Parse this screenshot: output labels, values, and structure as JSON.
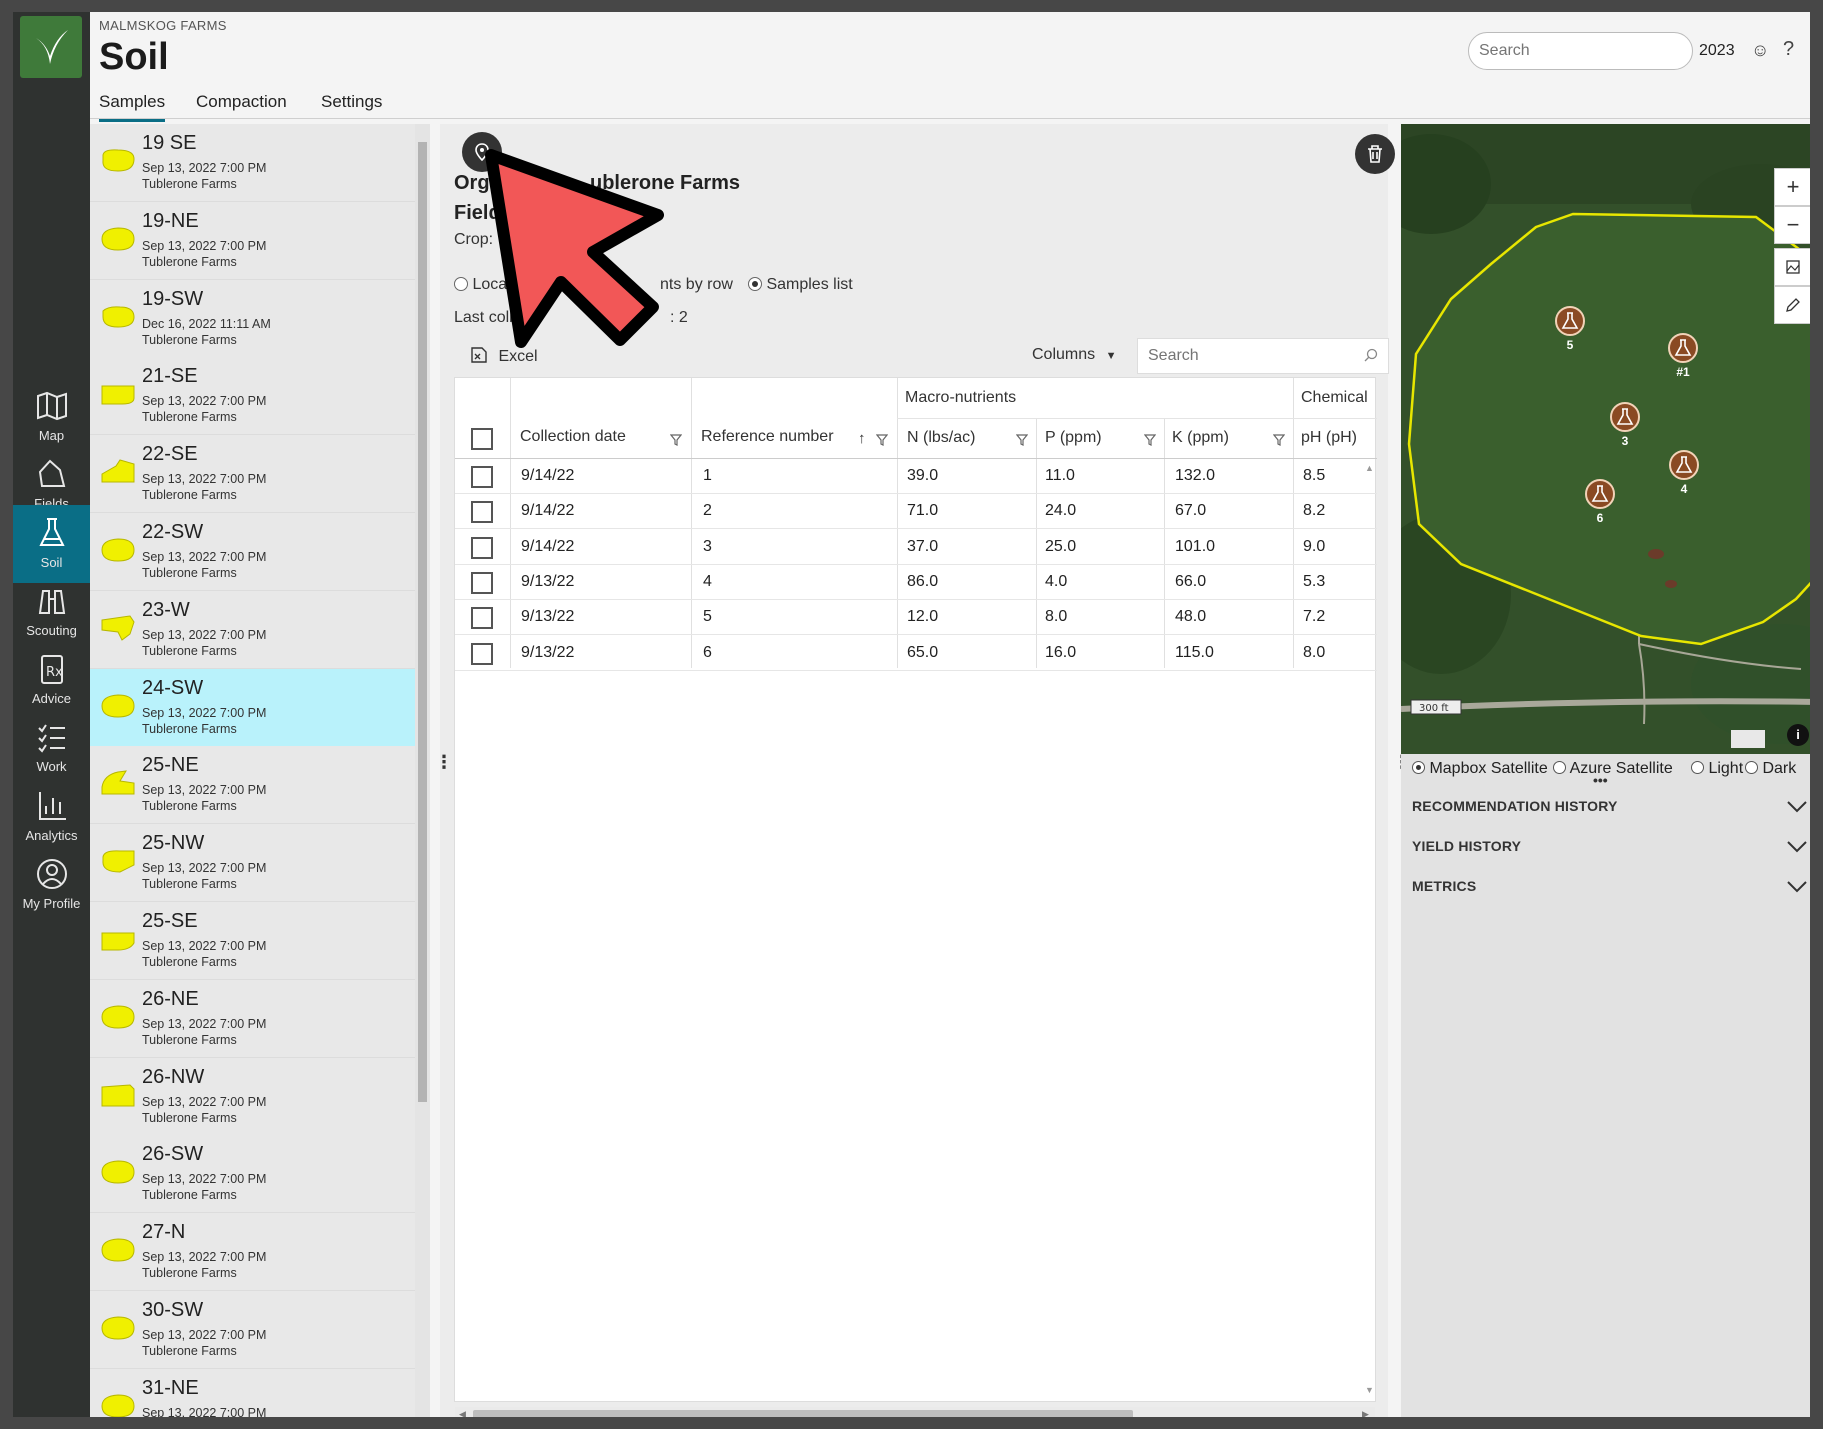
{
  "header": {
    "org": "MALMSKOG FARMS",
    "title": "Soil",
    "tabs": [
      "Samples",
      "Compaction",
      "Settings"
    ],
    "search_placeholder": "Search",
    "year": "2023",
    "smile_icon": "☺",
    "help_icon": "?"
  },
  "nav": {
    "items": [
      {
        "label": "Map",
        "icon": "map-icon"
      },
      {
        "label": "Fields",
        "icon": "fields-icon"
      },
      {
        "label": "Soil",
        "icon": "flask-icon",
        "active": true
      },
      {
        "label": "Scouting",
        "icon": "binoculars-icon"
      },
      {
        "label": "Advice",
        "icon": "rx-icon"
      },
      {
        "label": "Work",
        "icon": "checklist-icon"
      },
      {
        "label": "Analytics",
        "icon": "chart-icon"
      },
      {
        "label": "My Profile",
        "icon": "profile-icon"
      }
    ]
  },
  "fields": [
    {
      "name": "19 SE",
      "date": "Sep 13, 2022 7:00 PM",
      "farm": "Tublerone Farms"
    },
    {
      "name": "19-NE",
      "date": "Sep 13, 2022 7:00 PM",
      "farm": "Tublerone Farms"
    },
    {
      "name": "19-SW",
      "date": "Dec 16, 2022 11:11 AM",
      "farm": "Tublerone Farms"
    },
    {
      "name": "21-SE",
      "date": "Sep 13, 2022 7:00 PM",
      "farm": "Tublerone Farms"
    },
    {
      "name": "22-SE",
      "date": "Sep 13, 2022 7:00 PM",
      "farm": "Tublerone Farms"
    },
    {
      "name": "22-SW",
      "date": "Sep 13, 2022 7:00 PM",
      "farm": "Tublerone Farms"
    },
    {
      "name": "23-W",
      "date": "Sep 13, 2022 7:00 PM",
      "farm": "Tublerone Farms"
    },
    {
      "name": "24-SW",
      "date": "Sep 13, 2022 7:00 PM",
      "farm": "Tublerone Farms",
      "selected": true
    },
    {
      "name": "25-NE",
      "date": "Sep 13, 2022 7:00 PM",
      "farm": "Tublerone Farms"
    },
    {
      "name": "25-NW",
      "date": "Sep 13, 2022 7:00 PM",
      "farm": "Tublerone Farms"
    },
    {
      "name": "25-SE",
      "date": "Sep 13, 2022 7:00 PM",
      "farm": "Tublerone Farms"
    },
    {
      "name": "26-NE",
      "date": "Sep 13, 2022 7:00 PM",
      "farm": "Tublerone Farms"
    },
    {
      "name": "26-NW",
      "date": "Sep 13, 2022 7:00 PM",
      "farm": "Tublerone Farms"
    },
    {
      "name": "26-SW",
      "date": "Sep 13, 2022 7:00 PM",
      "farm": "Tublerone Farms"
    },
    {
      "name": "27-N",
      "date": "Sep 13, 2022 7:00 PM",
      "farm": "Tublerone Farms"
    },
    {
      "name": "30-SW",
      "date": "Sep 13, 2022 7:00 PM",
      "farm": "Tublerone Farms"
    },
    {
      "name": "31-NE",
      "date": "Sep 13, 2022 7:00 PM",
      "farm": "Tublerone Farms"
    }
  ],
  "detail": {
    "org_line_left": "Org",
    "org_line_right": "ublerone Farms",
    "field_line": "Field",
    "crop_label": "Crop:",
    "radio_location": "Locatio",
    "radio_by_row": "nts by row",
    "radio_samples": "Samples list",
    "last_collected": "Last collect",
    "last_collected_tail": ": 2",
    "excel_label": "Excel",
    "columns_label": "Columns",
    "table_search_placeholder": "Search"
  },
  "table": {
    "group_headers": {
      "macro": "Macro-nutrients",
      "chemical": "Chemical"
    },
    "headers": [
      "Collection date",
      "Reference number",
      "N (lbs/ac)",
      "P (ppm)",
      "K (ppm)",
      "pH (pH)"
    ],
    "sort_arrow": "↑",
    "rows": [
      [
        "9/14/22",
        "1",
        "39.0",
        "11.0",
        "132.0",
        "8.5"
      ],
      [
        "9/14/22",
        "2",
        "71.0",
        "24.0",
        "67.0",
        "8.2"
      ],
      [
        "9/14/22",
        "3",
        "37.0",
        "25.0",
        "101.0",
        "9.0"
      ],
      [
        "9/13/22",
        "4",
        "86.0",
        "4.0",
        "66.0",
        "5.3"
      ],
      [
        "9/13/22",
        "5",
        "12.0",
        "8.0",
        "48.0",
        "7.2"
      ],
      [
        "9/13/22",
        "6",
        "65.0",
        "16.0",
        "115.0",
        "8.0"
      ]
    ]
  },
  "map": {
    "scale_label": "300 ft",
    "markers": [
      "5",
      "#1",
      "3",
      "4",
      "6"
    ],
    "zoom_in": "+",
    "zoom_out": "−",
    "layers": [
      "Mapbox Satellite",
      "Azure Satellite",
      "Light",
      "Dark"
    ],
    "selected_layer": "Mapbox Satellite"
  },
  "accordion": [
    "RECOMMENDATION HISTORY",
    "YIELD HISTORY",
    "METRICS"
  ],
  "colors": {
    "accent": "#0a6e86",
    "field_yellow": "#f0f000",
    "cursor_red": "#f25757",
    "boundary": "#e7e600"
  }
}
